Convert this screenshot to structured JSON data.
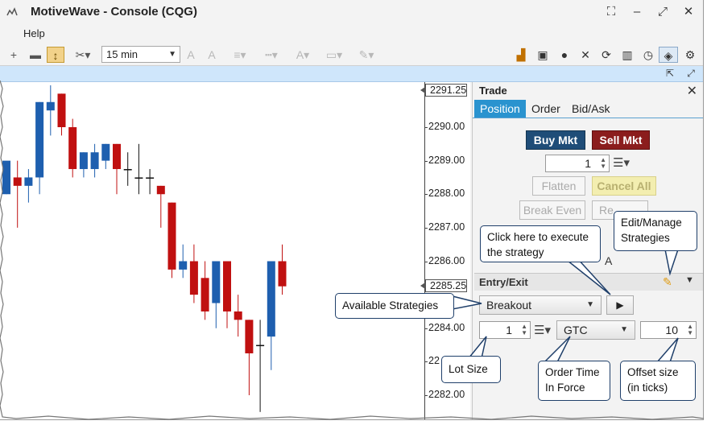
{
  "window": {
    "title": "MotiveWave - Console (CQG)",
    "menu": [
      "Help"
    ],
    "interval": "15 min"
  },
  "axis": {
    "price_tag_top": "2291.25",
    "price_tag_mid": "2285.25",
    "ticks": [
      {
        "label": "2290.00",
        "y": 2290.0
      },
      {
        "label": "2289.00",
        "y": 2289.0
      },
      {
        "label": "2288.00",
        "y": 2288.0
      },
      {
        "label": "2287.00",
        "y": 2287.0
      },
      {
        "label": "2286.00",
        "y": 2286.0
      },
      {
        "label": "2284.00",
        "y": 2284.0
      },
      {
        "label": "22",
        "y": 2283.0
      },
      {
        "label": "2282.00",
        "y": 2282.0
      }
    ]
  },
  "chart_data": {
    "type": "candlestick",
    "ylim": [
      2281.5,
      2291.3
    ],
    "bullish_color": "#1e5faf",
    "bearish_color": "#c01010",
    "candles": [
      {
        "o": 2288.0,
        "h": 2288.25,
        "c": 2289.0,
        "l": 2288.0
      },
      {
        "o": 2288.5,
        "h": 2289.0,
        "c": 2288.25,
        "l": 2287.0
      },
      {
        "o": 2288.25,
        "h": 2288.75,
        "c": 2288.5,
        "l": 2287.75
      },
      {
        "o": 2288.5,
        "h": 2290.75,
        "c": 2290.75,
        "l": 2288.0
      },
      {
        "o": 2290.5,
        "h": 2291.25,
        "c": 2290.75,
        "l": 2289.75
      },
      {
        "o": 2291.0,
        "h": 2291.0,
        "c": 2290.0,
        "l": 2289.75
      },
      {
        "o": 2290.0,
        "h": 2290.25,
        "c": 2288.75,
        "l": 2288.5
      },
      {
        "o": 2288.75,
        "h": 2289.25,
        "c": 2289.25,
        "l": 2288.5
      },
      {
        "o": 2288.75,
        "h": 2289.5,
        "c": 2289.25,
        "l": 2288.5
      },
      {
        "o": 2289.0,
        "h": 2289.5,
        "c": 2289.5,
        "l": 2288.75
      },
      {
        "o": 2289.5,
        "h": 2289.5,
        "c": 2288.75,
        "l": 2288.0
      },
      {
        "o": 2288.75,
        "h": 2289.25,
        "c": 2288.75,
        "l": 2288.25
      },
      {
        "o": 2288.5,
        "h": 2289.5,
        "c": 2288.5,
        "l": 2288.0
      },
      {
        "o": 2288.5,
        "h": 2288.75,
        "c": 2288.5,
        "l": 2288.0
      },
      {
        "o": 2288.25,
        "h": 2288.25,
        "c": 2288.0,
        "l": 2287.0
      },
      {
        "o": 2287.75,
        "h": 2287.75,
        "c": 2285.75,
        "l": 2285.5
      },
      {
        "o": 2285.75,
        "h": 2286.5,
        "c": 2286.0,
        "l": 2285.5
      },
      {
        "o": 2286.0,
        "h": 2286.5,
        "c": 2285.0,
        "l": 2284.75
      },
      {
        "o": 2285.5,
        "h": 2286.0,
        "c": 2284.5,
        "l": 2284.25
      },
      {
        "o": 2284.75,
        "h": 2286.0,
        "c": 2286.0,
        "l": 2284.0
      },
      {
        "o": 2286.0,
        "h": 2286.0,
        "c": 2284.5,
        "l": 2284.0
      },
      {
        "o": 2284.5,
        "h": 2285.0,
        "c": 2284.25,
        "l": 2283.75
      },
      {
        "o": 2284.25,
        "h": 2284.25,
        "c": 2283.25,
        "l": 2282.0
      },
      {
        "o": 2283.5,
        "h": 2284.25,
        "c": 2283.5,
        "l": 2281.5
      },
      {
        "o": 2283.75,
        "h": 2286.0,
        "c": 2286.0,
        "l": 2282.75
      },
      {
        "o": 2286.0,
        "h": 2286.5,
        "c": 2285.25,
        "l": 2285.0
      }
    ]
  },
  "trade_panel": {
    "title": "Trade",
    "tabs": [
      "Position",
      "Order",
      "Bid/Ask"
    ],
    "active_tab": "Position",
    "buy_label": "Buy Mkt",
    "sell_label": "Sell Mkt",
    "quantity": "1",
    "flatten_label": "Flatten",
    "cancel_all_label": "Cancel All",
    "break_even_label": "Break Even",
    "reverse_label": "Re",
    "hidden_label": "A",
    "entry_exit_title": "Entry/Exit",
    "strategy": "Breakout",
    "lot_size": "1",
    "tif": "GTC",
    "offset": "10"
  },
  "callouts": {
    "execute": "Click here to execute the strategy",
    "edit": "Edit/Manage Strategies",
    "available": "Available Strategies",
    "lot": "Lot Size",
    "tif": "Order Time In Force",
    "offset": "Offset size (in ticks)"
  },
  "colors": {
    "accent_tab": "#2a93cf",
    "buy": "#1f4d78",
    "sell": "#8b1d1d",
    "callout_border": "#1f3f6a"
  }
}
